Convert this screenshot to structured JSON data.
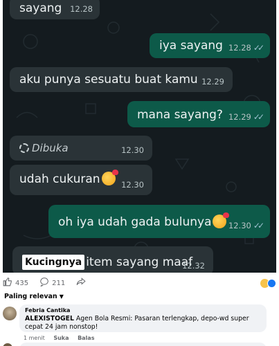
{
  "chat": {
    "messages": [
      {
        "text": "sayang",
        "time": "12.28",
        "dir": "in"
      },
      {
        "text": "iya sayang",
        "time": "12.28",
        "dir": "out",
        "read": true
      },
      {
        "text": "aku punya sesuatu buat kamu",
        "time": "12.29",
        "dir": "in"
      },
      {
        "text": "mana sayang?",
        "time": "12.29",
        "dir": "out",
        "read": true
      },
      {
        "text": "Dibuka",
        "time": "12.30",
        "dir": "in",
        "view_once": true
      },
      {
        "text": "udah cukuran",
        "time": "12.30",
        "dir": "in",
        "emoji": "smiling-face-with-hearts"
      },
      {
        "text": "oh iya udah gada bulunya",
        "time": "12.30",
        "dir": "out",
        "read": true,
        "emoji": "face-blowing-kiss"
      },
      {
        "sticker": "Kucingnya",
        "text": "item sayang maaf",
        "time": "12.32",
        "dir": "in"
      }
    ],
    "read_ticks": "✓✓"
  },
  "post_footer": {
    "like_count": "435",
    "comment_count": "211",
    "like_icon": "thumbs-up-icon",
    "comment_icon": "comment-icon",
    "share_icon": "share-icon",
    "reaction_icons": [
      "haha-icon",
      "like-icon"
    ]
  },
  "comments_sort": {
    "label": "Paling relevan"
  },
  "comment": {
    "author": "Febria Cantika",
    "mention": "ALEXISTOGEL",
    "text": " Agen Bola Resmi: Pasaran terlengkap, depo-wd super cepat 24 jam nonstop!",
    "time": "1 menit",
    "like_label": "Suka",
    "reply_label": "Balas"
  }
}
